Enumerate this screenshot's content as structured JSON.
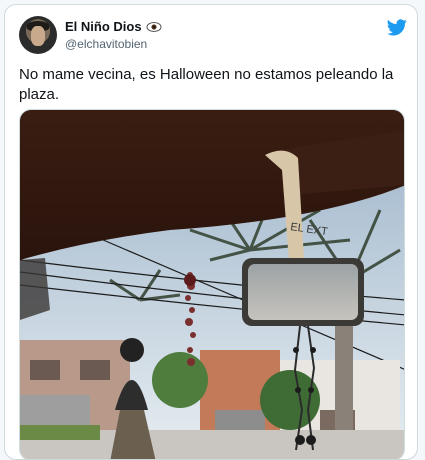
{
  "tweet": {
    "display_name": "El Niño Dios",
    "handle": "@elchavitobien",
    "text": "No mame vecina, es Halloween no estamos peleando la plaza.",
    "name_emoji_icon": "eye-icon",
    "brand_icon": "twitter-bird-icon",
    "brand_color": "#1d9bf0"
  },
  "media": {
    "sign_text": "EL EXT"
  }
}
